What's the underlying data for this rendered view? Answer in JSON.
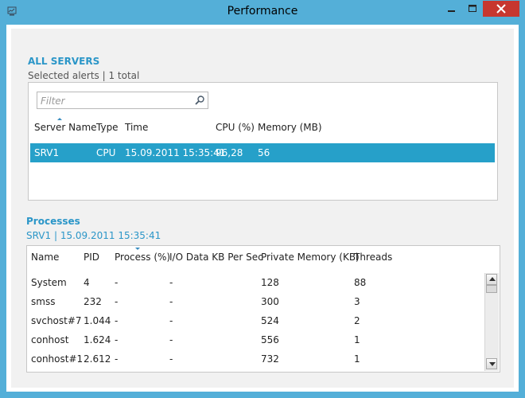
{
  "window": {
    "title": "Performance",
    "accent_color": "#54afd8",
    "close_color": "#c7372f",
    "icons": {
      "app": "performance-app-icon",
      "min": "minimize-icon",
      "max": "maximize-icon",
      "close": "close-icon"
    }
  },
  "all_servers": {
    "title": "ALL SERVERS",
    "subtitle": "Selected alerts | 1 total",
    "filter_placeholder": "Filter",
    "columns": [
      "Server Name",
      "Type",
      "Time",
      "CPU (%)",
      "Memory (MB)"
    ],
    "rows": [
      {
        "server": "SRV1",
        "type": "CPU",
        "time": "15.09.2011 15:35:41",
        "cpu": "96,28",
        "memory": "56",
        "selected": true
      }
    ],
    "selection_color": "#26a0c9"
  },
  "processes": {
    "title": "Processes",
    "subtitle": "SRV1 | 15.09.2011 15:35:41",
    "columns": [
      "Name",
      "PID",
      "Process (%)",
      "I/O Data KB Per Sec",
      "Private Memory (KB)",
      "Threads"
    ],
    "rows": [
      {
        "name": "System",
        "pid": "4",
        "process": "-",
        "io": "-",
        "memory": "128",
        "threads": "88"
      },
      {
        "name": "smss",
        "pid": "232",
        "process": "-",
        "io": "-",
        "memory": "300",
        "threads": "3"
      },
      {
        "name": "svchost#7",
        "pid": "1.044",
        "process": "-",
        "io": "-",
        "memory": "524",
        "threads": "2"
      },
      {
        "name": "conhost",
        "pid": "1.624",
        "process": "-",
        "io": "-",
        "memory": "556",
        "threads": "1"
      },
      {
        "name": "conhost#1",
        "pid": "2.612",
        "process": "-",
        "io": "-",
        "memory": "732",
        "threads": "1"
      }
    ]
  }
}
